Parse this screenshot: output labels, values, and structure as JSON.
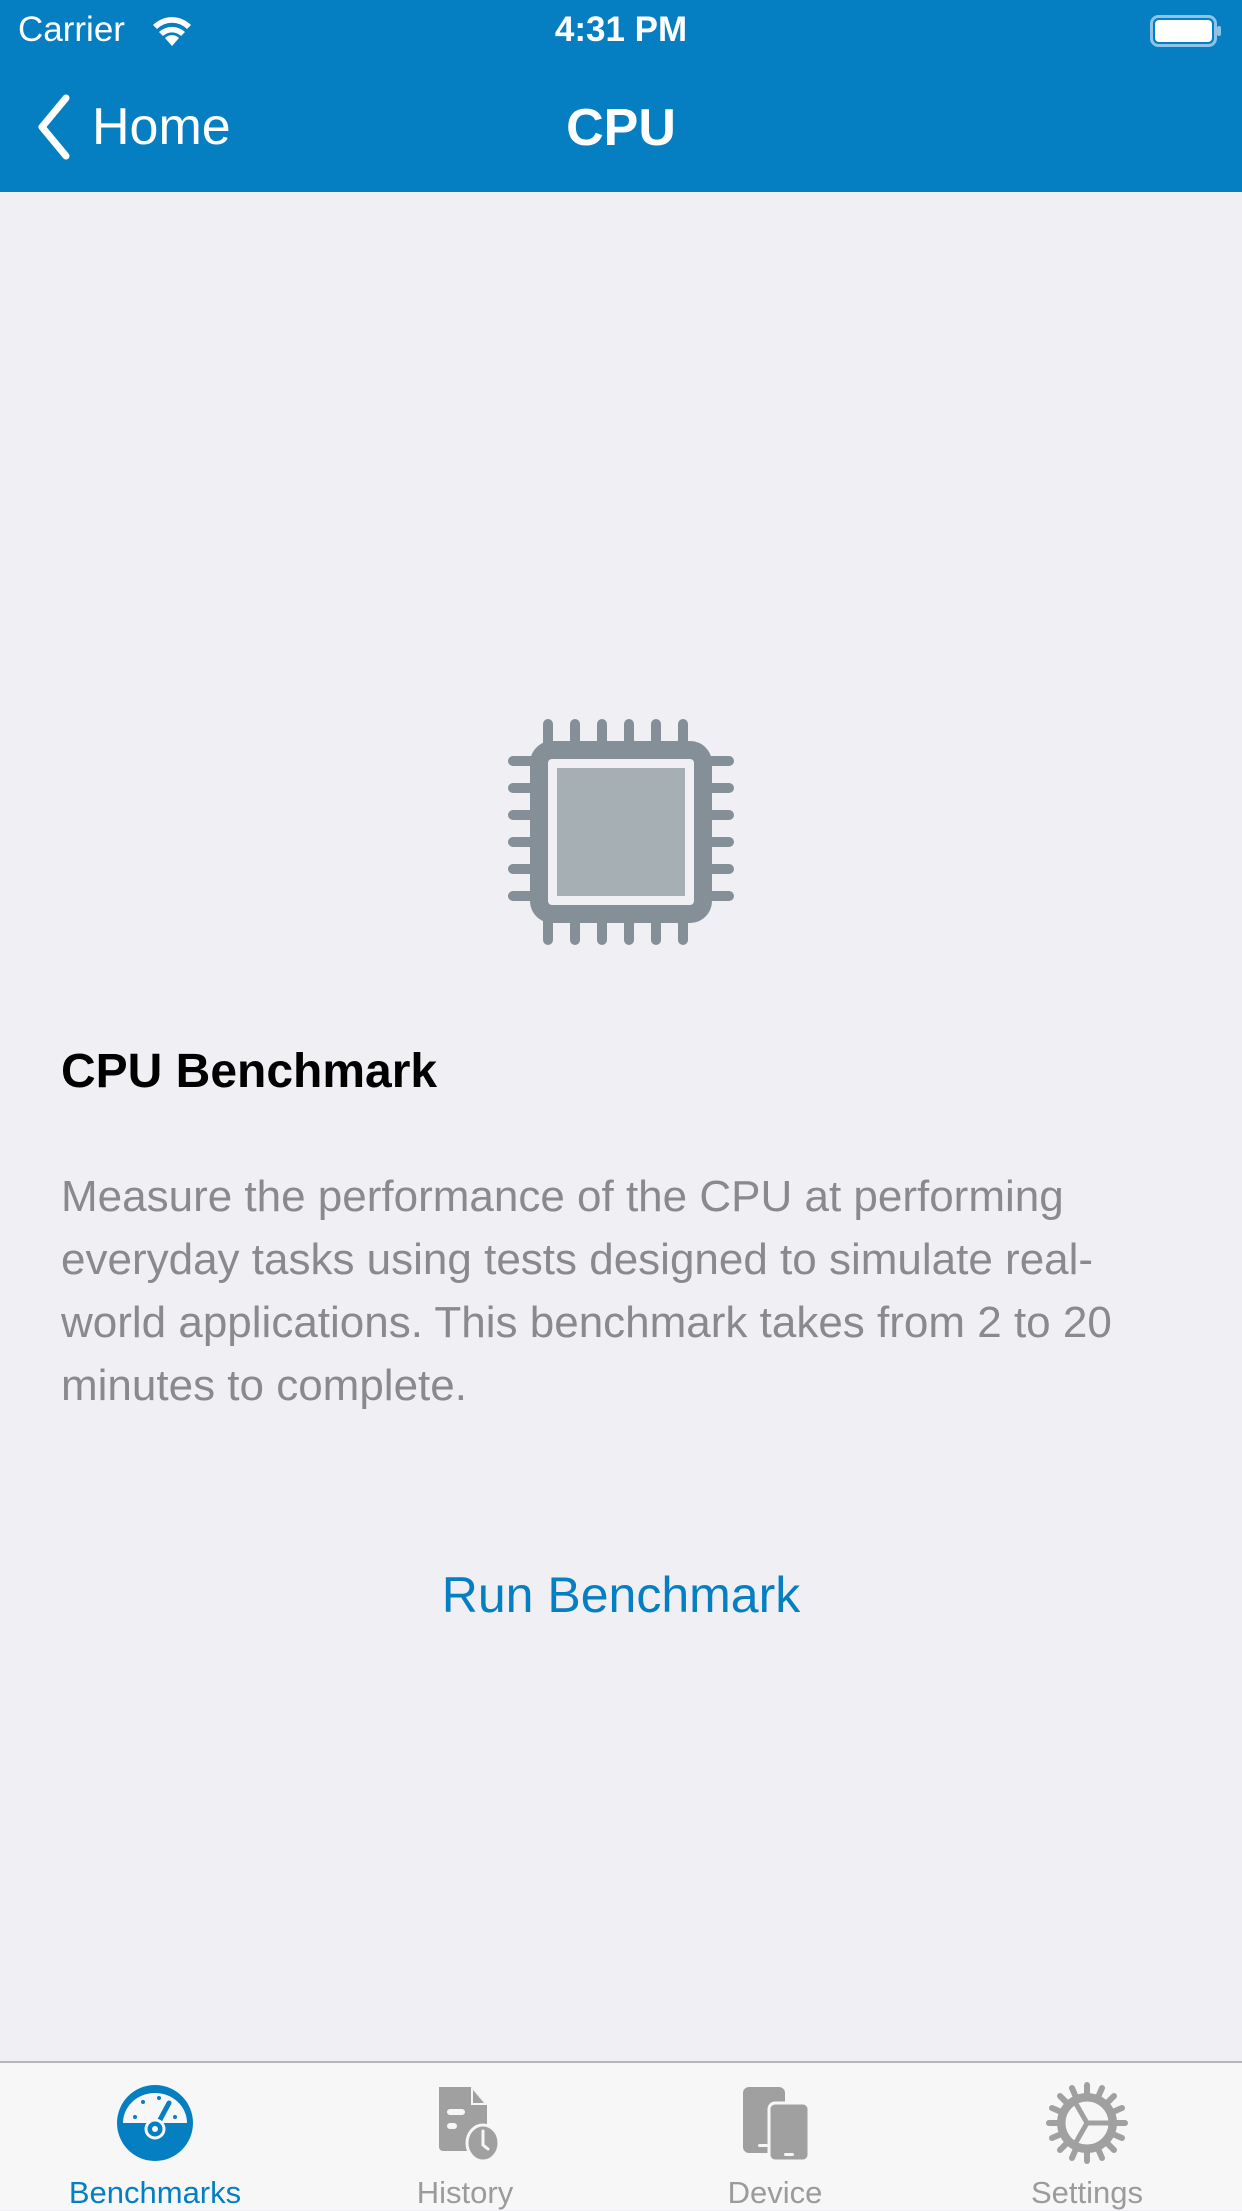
{
  "status_bar": {
    "carrier": "Carrier",
    "time": "4:31 PM",
    "wifi_icon": "wifi-icon",
    "battery_icon": "battery-full-icon"
  },
  "nav": {
    "back_label": "Home",
    "title": "CPU"
  },
  "content": {
    "icon": "cpu-chip-icon",
    "title": "CPU Benchmark",
    "description": "Measure the performance of the CPU at performing everyday tasks using tests designed to simulate real-world applications. This benchmark takes from 2 to 20 minutes to complete.",
    "run_button_label": "Run Benchmark"
  },
  "tabs": [
    {
      "label": "Benchmarks",
      "icon": "gauge-icon",
      "active": true
    },
    {
      "label": "History",
      "icon": "document-clock-icon",
      "active": false
    },
    {
      "label": "Device",
      "icon": "devices-icon",
      "active": false
    },
    {
      "label": "Settings",
      "icon": "gear-icon",
      "active": false
    }
  ],
  "colors": {
    "brand": "#067fc2",
    "background": "#efeff4",
    "icon_gray": "#848f97",
    "inactive_tab": "#9b9b9b"
  }
}
